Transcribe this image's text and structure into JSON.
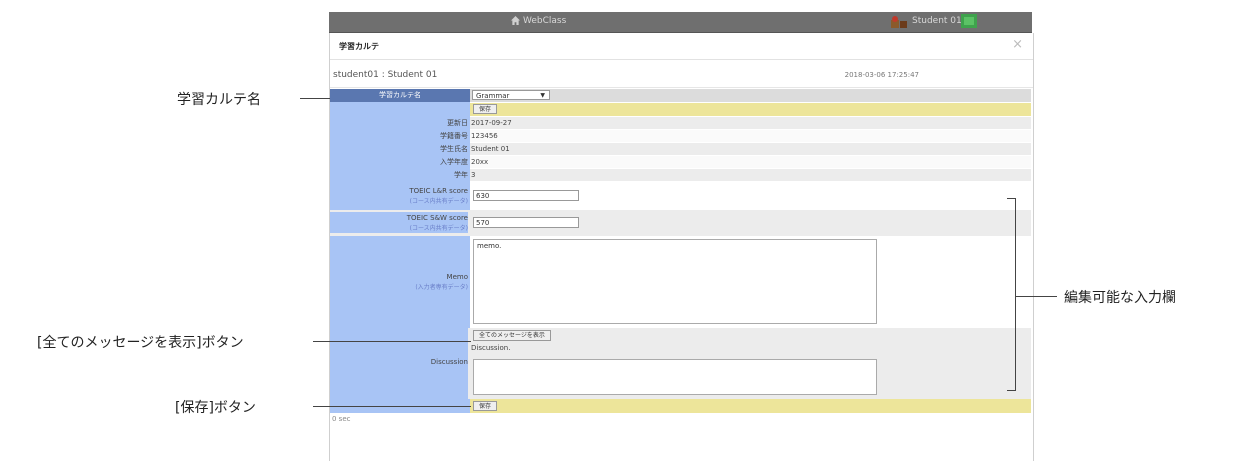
{
  "topbar": {
    "brand": "WebClass",
    "user": "Student 01"
  },
  "modal": {
    "title": "学習カルテ",
    "close": "×",
    "student": "student01 : Student 01",
    "timestamp": "2018-03-06 17:25:47"
  },
  "form": {
    "karte_label": "学習カルテ名",
    "karte_select": "Grammar",
    "save_label": "保存",
    "fields": [
      {
        "label": "更新日",
        "value": "2017-09-27"
      },
      {
        "label": "学籍番号",
        "value": "123456"
      },
      {
        "label": "学生氏名",
        "value": "Student 01"
      },
      {
        "label": "入学年度",
        "value": "20xx"
      },
      {
        "label": "学年",
        "value": "3"
      }
    ],
    "toeic_lr": {
      "label": "TOEIC L&R score",
      "sub": "(コース内共有データ)",
      "value": "630"
    },
    "toeic_sw": {
      "label": "TOEIC S&W score",
      "sub": "(コース内共有データ)",
      "value": "570"
    },
    "memo": {
      "label": "Memo",
      "sub": "(入力者専有データ)",
      "value": "memo."
    },
    "show_all_label": "全てのメッセージを表示",
    "discussion": {
      "label": "Discussion",
      "text": "Discussion.",
      "value": ""
    },
    "footer": "0 sec"
  },
  "annotations": {
    "karte_name": "学習カルテ名",
    "editable": "編集可能な入力欄",
    "show_all": "[全てのメッセージを表示]ボタン",
    "save": "[保存]ボタン"
  }
}
